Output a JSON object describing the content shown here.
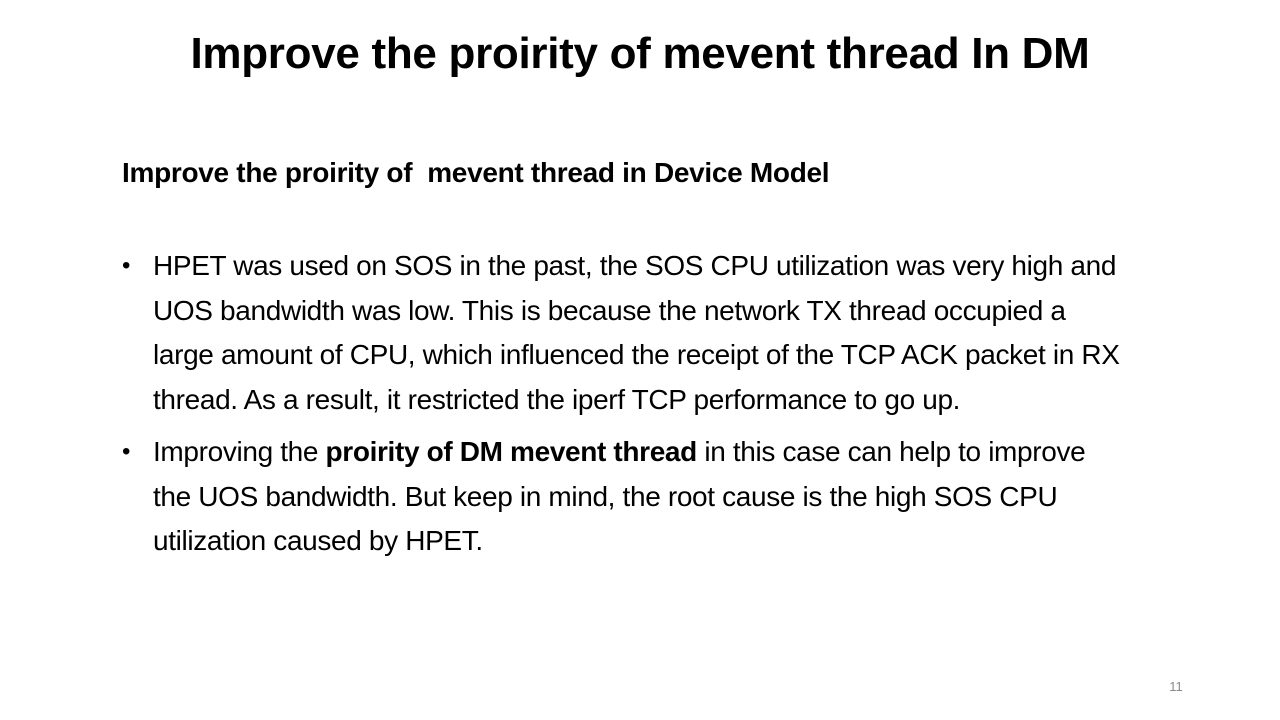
{
  "slide": {
    "title": "Improve the proirity of mevent thread In DM",
    "subtitle": "Improve the proirity of  mevent thread in Device Model",
    "bullets": [
      {
        "marker": "•",
        "text": "HPET was used on SOS in the past, the SOS CPU utilization was very high and UOS bandwidth was low. This is because the network TX thread occupied a large amount of CPU, which influenced the receipt of the TCP ACK packet in RX thread. As a result, it restricted the iperf TCP performance to go up."
      },
      {
        "marker": "•",
        "text_before": "Improving the ",
        "text_bold": "proirity of DM mevent thread",
        "text_after": " in this case can help to improve the UOS bandwidth. But keep in mind, the root cause is the high SOS CPU utilization caused by HPET."
      }
    ],
    "page_number": "11"
  }
}
